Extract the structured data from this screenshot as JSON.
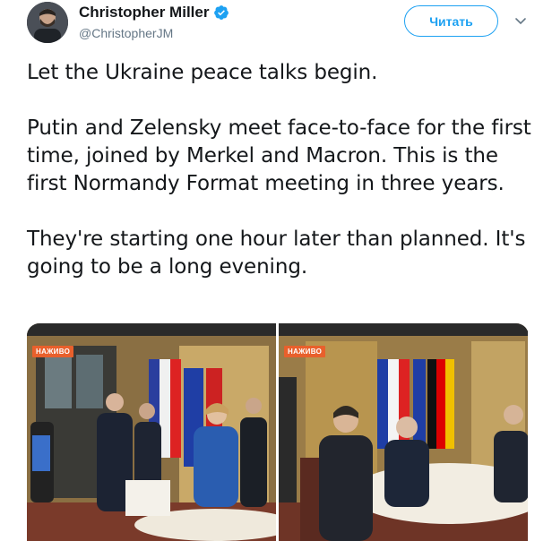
{
  "author": {
    "name": "Christopher Miller",
    "handle": "@ChristopherJM",
    "verified": true,
    "avatar_icon": "person-photo"
  },
  "actions": {
    "follow_label": "Читать",
    "more_icon": "chevron-down-icon"
  },
  "tweet": {
    "paragraphs": [
      "Let the Ukraine peace talks begin.",
      "Putin and Zelensky meet face-to-face for the first time, joined by Merkel and Macron. This is the first Normandy Format meeting in three years.",
      "They're starting one hour later than planned. It's going to be a long evening."
    ]
  },
  "media": {
    "photos": [
      {
        "badge": "НАЖИВО"
      },
      {
        "badge": "НАЖИВО"
      }
    ]
  },
  "colors": {
    "accent": "#1da1f2",
    "text": "#14171a",
    "secondary": "#657786",
    "badge": "#e8602c"
  }
}
